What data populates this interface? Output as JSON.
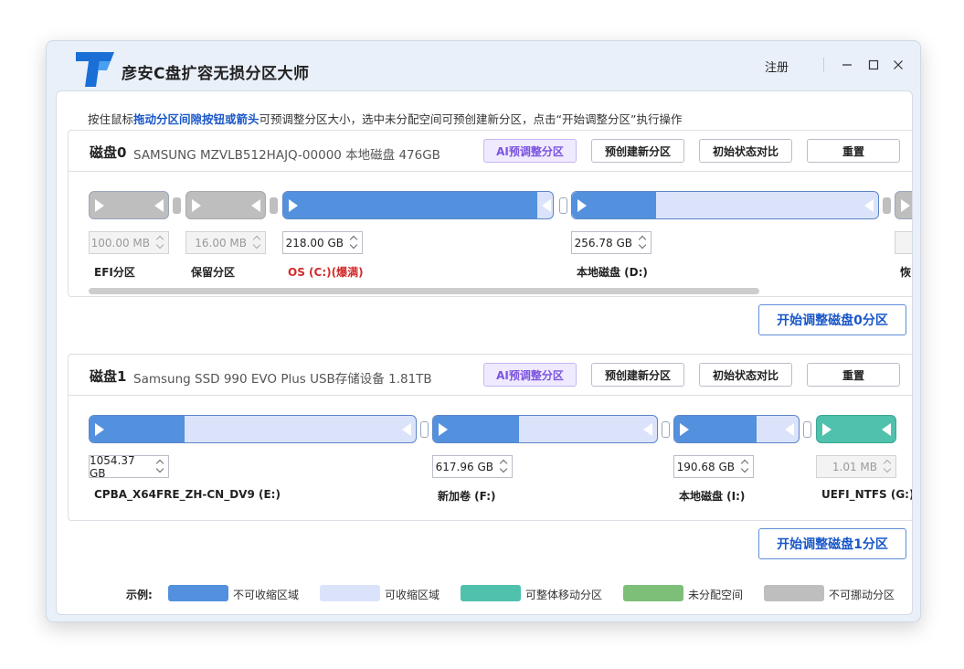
{
  "app": {
    "title": "彦安C盘扩容无损分区大师",
    "register": "注册"
  },
  "colors": {
    "non_shrinkable": "#5390dd",
    "shrinkable": "#dbe3fb",
    "movable": "#4fc1ad",
    "unallocated": "#7dbf79",
    "fixed": "#bebebe"
  },
  "hint": {
    "prefix": "按住鼠标",
    "highlight": "拖动分区间隙按钮或箭头",
    "suffix": "可预调整分区大小，选中未分配空间可预创建新分区，点击“开始调整分区”执行操作"
  },
  "buttons": {
    "ai": "AI预调整分区",
    "precreate": "预创建新分区",
    "compare": "初始状态对比",
    "reset": "重置"
  },
  "disks": [
    {
      "name": "磁盘0",
      "desc": "SAMSUNG MZVLB512HAJQ-00000 本地磁盘 476GB",
      "start_button": "开始调整磁盘0分区",
      "partitions": [
        {
          "label": "EFI分区",
          "size": "100.00 MB",
          "type": "fixed"
        },
        {
          "label": "保留分区",
          "size": "16.00 MB",
          "type": "fixed"
        },
        {
          "label": "OS (C:)(爆满)",
          "size": "218.00 GB",
          "type": "system",
          "full": true
        },
        {
          "label": "本地磁盘 (D:)",
          "size": "256.78 GB",
          "type": "data"
        },
        {
          "label": "恢",
          "size": "",
          "type": "fixed"
        }
      ]
    },
    {
      "name": "磁盘1",
      "desc": "Samsung SSD 990 EVO Plus USB存储设备 1.81TB",
      "start_button": "开始调整磁盘1分区",
      "partitions": [
        {
          "label": "CPBA_X64FRE_ZH-CN_DV9 (E:)",
          "size": "1054.37 GB",
          "type": "data"
        },
        {
          "label": "新加卷 (F:)",
          "size": "617.96 GB",
          "type": "data"
        },
        {
          "label": "本地磁盘 (I:)",
          "size": "190.68 GB",
          "type": "data"
        },
        {
          "label": "UEFI_NTFS (G:)",
          "size": "1.01 MB",
          "type": "movable"
        }
      ]
    }
  ],
  "legend": {
    "title": "示例:",
    "items": [
      {
        "label": "不可收缩区域"
      },
      {
        "label": "可收缩区域"
      },
      {
        "label": "可整体移动分区"
      },
      {
        "label": "未分配空间"
      },
      {
        "label": "不可挪动分区"
      }
    ]
  }
}
